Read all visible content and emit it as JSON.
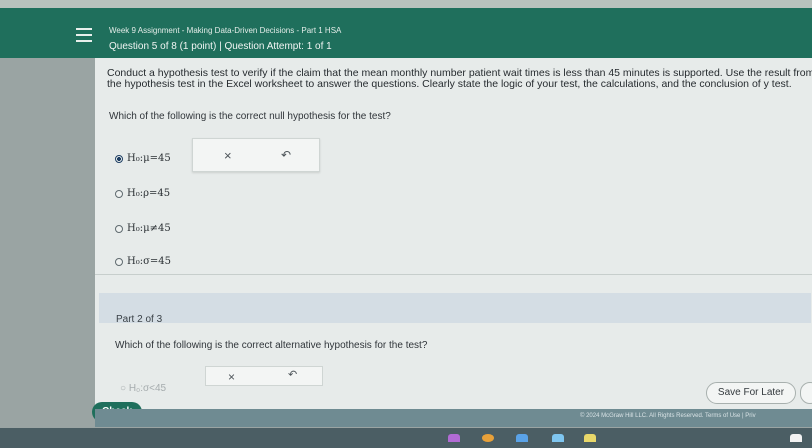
{
  "header": {
    "title": "Week 9 Assignment - Making Data-Driven Decisions - Part 1 HSA",
    "question_info": "Question 5 of 8 (1 point)  |  Question Attempt: 1 of 1"
  },
  "prompt": "Conduct a hypothesis test to verify if the claim that the mean monthly number patient wait times is less than 45 minutes is supported. Use the result from the hypothesis test in the Excel worksheet to answer the questions. Clearly state the logic of your test, the calculations, and the conclusion of y test.",
  "question": "Which of the following is the correct null hypothesis for the test?",
  "options": [
    {
      "label": "H₀:μ=45",
      "selected": true
    },
    {
      "label": "H₀:ρ=45",
      "selected": false
    },
    {
      "label": "H₀:μ≠45",
      "selected": false
    },
    {
      "label": "H₀:σ=45",
      "selected": false
    }
  ],
  "answer_box": {
    "clear_icon": "×",
    "undo_icon": "↶"
  },
  "part2": {
    "label": "Part 2 of 3",
    "question": "Which of the following is the correct alternative hypothesis for the test?",
    "partial_option": "○ H₀:σ<45"
  },
  "buttons": {
    "check": "Check",
    "save": "Save For Later"
  },
  "footer": {
    "copyright": "© 2024 McGraw Hill LLC. All Rights Reserved.   Terms of Use  |  Priv"
  },
  "colors": {
    "header": "#1f6f5c",
    "check_button": "#1f6f5c",
    "background": "#e7ebea"
  }
}
